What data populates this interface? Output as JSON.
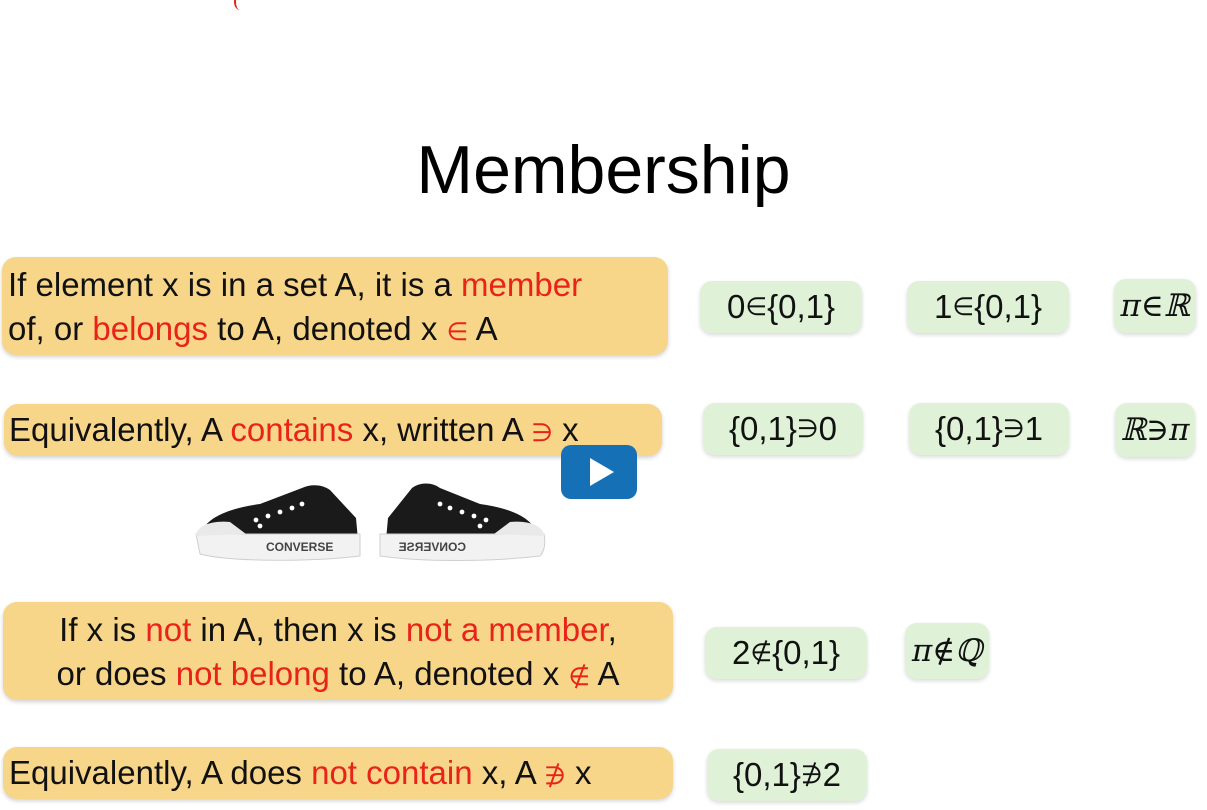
{
  "title": "Membership",
  "definitions": {
    "member": {
      "p1": "If element x is in a set A, it is a ",
      "p2": "member",
      "p3": "of, or ",
      "p4": "belongs",
      "p5": " to A, denoted x ",
      "p6": "∈",
      "p7": " A"
    },
    "contains": {
      "p1": "Equivalently, A ",
      "p2": "contains",
      "p3": " x, written A ",
      "p4": "∋",
      "p5": " x"
    },
    "not_member": {
      "p1": "If x is ",
      "p2": "not",
      "p3": " in A, then x is ",
      "p4": "not a member",
      "p5": ",",
      "p6": "or does ",
      "p7": "not belong",
      "p8": " to A, denoted x ",
      "p9": "∉",
      "p10": " A"
    },
    "not_contains": {
      "p1": "Equivalently, A does ",
      "p2": "not contain",
      "p3": " x, A ",
      "p4": "∌",
      "p5": " x"
    }
  },
  "examples": {
    "ex1": {
      "a": "0 ",
      "sym": "∈",
      "b": " {0,1}"
    },
    "ex2": {
      "a": "1 ",
      "sym": "∈",
      "b": " {0,1}"
    },
    "ex3": "π∈ℝ",
    "ex4": {
      "a": "{0,1} ",
      "sym": "∋",
      "b": " 0"
    },
    "ex5": {
      "a": "{0,1} ",
      "sym": "∋",
      "b": " 1"
    },
    "ex6": "ℝ∋π",
    "ex7": {
      "a": "2 ",
      "sym": "∉",
      "b": " {0,1}"
    },
    "ex8": "π∉ℚ",
    "ex9": {
      "a": "{0,1} ",
      "sym": "∌",
      "b": " 2"
    }
  },
  "shoes": {
    "left_brand": "CONVERSE",
    "right_brand": "CONVERSE"
  },
  "colors": {
    "highlight": "#f7d68a",
    "example_bg": "#dff2d8",
    "accent_red": "#e8231a",
    "play_blue": "#1670b5"
  },
  "icons": {
    "play": "play-icon"
  }
}
